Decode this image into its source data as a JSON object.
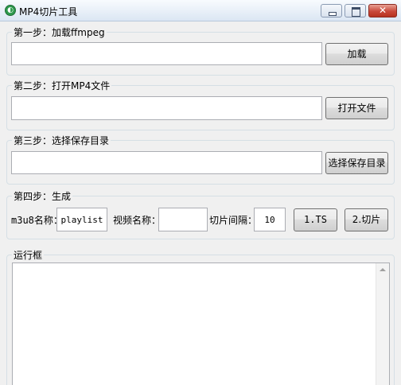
{
  "window": {
    "title": "MP4切片工具",
    "close_glyph": "✕"
  },
  "step1": {
    "title": "第一步：加载ffmpeg",
    "path_value": "",
    "button_label": "加载"
  },
  "step2": {
    "title": "第二步：打开MP4文件",
    "path_value": "",
    "button_label": "打开文件"
  },
  "step3": {
    "title": "第三步：选择保存目录",
    "path_value": "",
    "button_label": "选择保存目录"
  },
  "step4": {
    "title": "第四步：生成",
    "m3u8_label": "m3u8名称：",
    "m3u8_value": "playlist",
    "video_name_label": "视频名称：",
    "video_name_value": "",
    "interval_label": "切片间隔：",
    "interval_value": "10",
    "ts_button": "1.TS",
    "slice_button": "2.切片"
  },
  "log": {
    "title": "运行框",
    "content": ""
  }
}
